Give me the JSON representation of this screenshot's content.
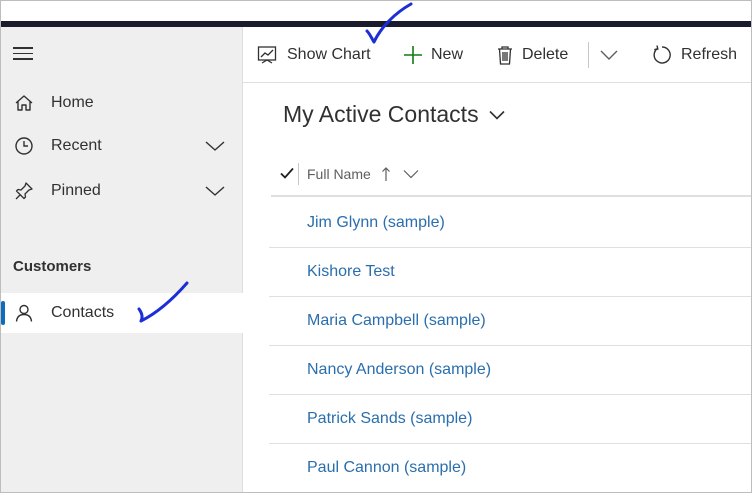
{
  "toolbar": {
    "show_chart": "Show Chart",
    "new": "New",
    "delete": "Delete",
    "refresh": "Refresh"
  },
  "sidebar": {
    "items": [
      {
        "label": "Home",
        "icon": "home-icon"
      },
      {
        "label": "Recent",
        "icon": "clock-icon"
      },
      {
        "label": "Pinned",
        "icon": "pin-icon"
      }
    ],
    "section_title": "Customers",
    "section_items": [
      {
        "label": "Contacts",
        "icon": "person-icon",
        "active": true
      }
    ]
  },
  "main": {
    "view_title": "My Active Contacts",
    "column_header": "Full Name",
    "rows": [
      "Jim Glynn (sample)",
      "Kishore Test",
      "Maria Campbell (sample)",
      "Nancy Anderson (sample)",
      "Patrick Sands (sample)",
      "Paul Cannon (sample)"
    ]
  },
  "colors": {
    "accent": "#0f6cbd",
    "link": "#2a6ead",
    "new_plus": "#107c10",
    "annotation": "#1c2fd6",
    "topbar": "#1b1b2e"
  }
}
